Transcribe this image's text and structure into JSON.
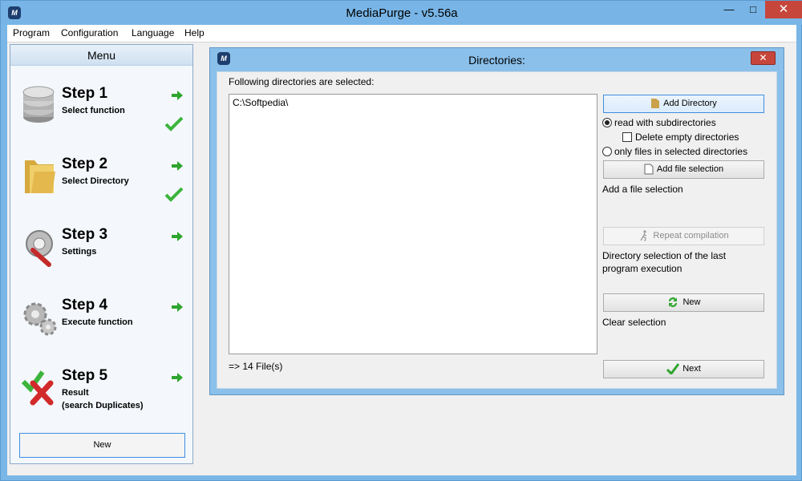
{
  "window": {
    "title": "MediaPurge - v5.56a",
    "app_icon": "app-logo-icon"
  },
  "menubar": [
    "Program",
    "Configuration",
    "Language",
    "Help"
  ],
  "left_panel": {
    "header": "Menu",
    "steps": [
      {
        "title": "Step 1",
        "subtitle": "Select function",
        "icon": "database-icon",
        "done": true
      },
      {
        "title": "Step 2",
        "subtitle": "Select Directory",
        "icon": "folder-icon",
        "done": true
      },
      {
        "title": "Step 3",
        "subtitle": "Settings",
        "icon": "settings-wrench-icon",
        "done": false
      },
      {
        "title": "Step 4",
        "subtitle": "Execute function",
        "icon": "gears-icon",
        "done": false
      },
      {
        "title": "Step 5",
        "subtitle": "Result\n(search Duplicates)",
        "icon": "result-check-cross-icon",
        "done": false
      }
    ],
    "new_button": "New"
  },
  "dialog": {
    "title": "Directories:",
    "label": "Following directories are selected:",
    "directories": [
      "C:\\Softpedia\\"
    ],
    "file_count": "=> 14 File(s)",
    "add_directory": "Add Directory",
    "read_subdirs": "read with subdirectories",
    "delete_empty": "Delete empty directories",
    "only_files": "only files in selected directories",
    "add_file_selection": "Add file selection",
    "add_file_note": "Add a file selection",
    "repeat_compilation": "Repeat compilation",
    "repeat_note": "Directory selection of the last program execution",
    "new": "New",
    "clear_note": "Clear selection",
    "next": "Next"
  },
  "colors": {
    "accent": "#3d8ee0",
    "titlebar": "#78b5e6",
    "close": "#c7463b"
  }
}
